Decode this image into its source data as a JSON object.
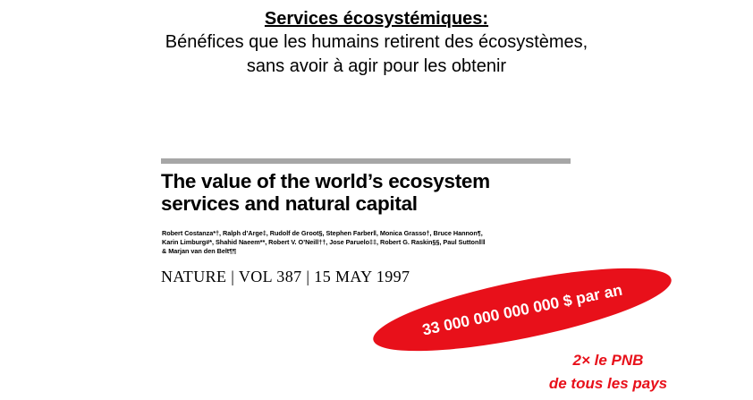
{
  "header": {
    "title": "Services écosystémiques:",
    "subtitle_lines": [
      "Bénéfices que les humains retirent des écosystèmes,",
      "sans avoir à agir pour les obtenir"
    ]
  },
  "paper": {
    "title_lines": [
      "The value of the world’s ecosystem",
      "services and natural capital"
    ],
    "author_lines": [
      "Robert Costanza*†, Ralph d’Arge‡, Rudolf de Groot§, Stephen Farber‖, Monica Grasso†, Bruce Hannon¶,",
      "Karin Limburg#*, Shahid Naeem**, Robert V. O’Neill††, Jose Paruelo‡‡, Robert G. Raskin§§, Paul Sutton‖‖",
      "& Marjan van den Belt¶¶"
    ],
    "citation": "NATURE | VOL 387 | 15 MAY 1997"
  },
  "highlight": {
    "value_text": "33 000 000 000 000 $ par an",
    "color": "#e8101a"
  },
  "note": {
    "lines": [
      "2× le PNB",
      "de tous les pays"
    ],
    "color": "#e8101a"
  }
}
